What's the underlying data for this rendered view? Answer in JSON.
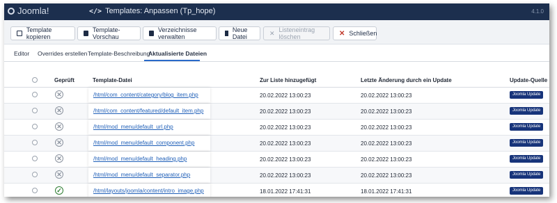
{
  "header": {
    "logo_text": "Joomla!",
    "code_icon": "</>",
    "title": "Templates: Anpassen (Tp_hope)",
    "version": "4.1.0"
  },
  "toolbar": {
    "buttons": [
      {
        "label": "Template kopieren",
        "icon": "copy-icon"
      },
      {
        "label": "Template-Vorschau",
        "icon": "image-icon"
      },
      {
        "label": "Verzeichnisse verwalten",
        "icon": "folder-icon"
      },
      {
        "label": "Neue Datei",
        "icon": "file-icon"
      },
      {
        "label": "Listeneintrag löschen",
        "icon": "times-icon"
      },
      {
        "label": "Schließen",
        "icon": "close-icon"
      }
    ]
  },
  "tabs": [
    {
      "label": "Editor"
    },
    {
      "label": "Overrides erstellen"
    },
    {
      "label": "Template-Beschreibung"
    },
    {
      "label": "Aktualisierte Dateien",
      "active": true
    }
  ],
  "table": {
    "columns": {
      "checked": "Geprüft",
      "file": "Template-Datei",
      "added": "Zur Liste hinzugefügt",
      "modified": "Letzte Änderung durch ein Update",
      "source": "Update-Quelle"
    },
    "rows": [
      {
        "checked": false,
        "status_glyph": "✕",
        "file": "/html/com_content/category/blog_item.php",
        "added": "20.02.2022 13:00:23",
        "modified": "20.02.2022 13:00:23",
        "source": "Joomla Update"
      },
      {
        "checked": false,
        "status_glyph": "✕",
        "file": "/html/com_content/featured/default_item.php",
        "added": "20.02.2022 13:00:23",
        "modified": "20.02.2022 13:00:23",
        "source": "Joomla Update"
      },
      {
        "checked": false,
        "status_glyph": "✕",
        "file": "/html/mod_menu/default_url.php",
        "added": "20.02.2022 13:00:23",
        "modified": "20.02.2022 13:00:23",
        "source": "Joomla Update"
      },
      {
        "checked": false,
        "status_glyph": "✕",
        "file": "/html/mod_menu/default_component.php",
        "added": "20.02.2022 13:00:23",
        "modified": "20.02.2022 13:00:23",
        "source": "Joomla Update"
      },
      {
        "checked": false,
        "status_glyph": "✕",
        "file": "/html/mod_menu/default_heading.php",
        "added": "20.02.2022 13:00:23",
        "modified": "20.02.2022 13:00:23",
        "source": "Joomla Update"
      },
      {
        "checked": false,
        "status_glyph": "✕",
        "file": "/html/mod_menu/default_separator.php",
        "added": "20.02.2022 13:00:23",
        "modified": "20.02.2022 13:00:23",
        "source": "Joomla Update"
      },
      {
        "checked": true,
        "status_glyph": "✓",
        "file": "/html/layouts/joomla/content/intro_image.php",
        "added": "18.01.2022 17:41:31",
        "modified": "18.01.2022 17:41:31",
        "source": "Joomla Update"
      }
    ]
  }
}
